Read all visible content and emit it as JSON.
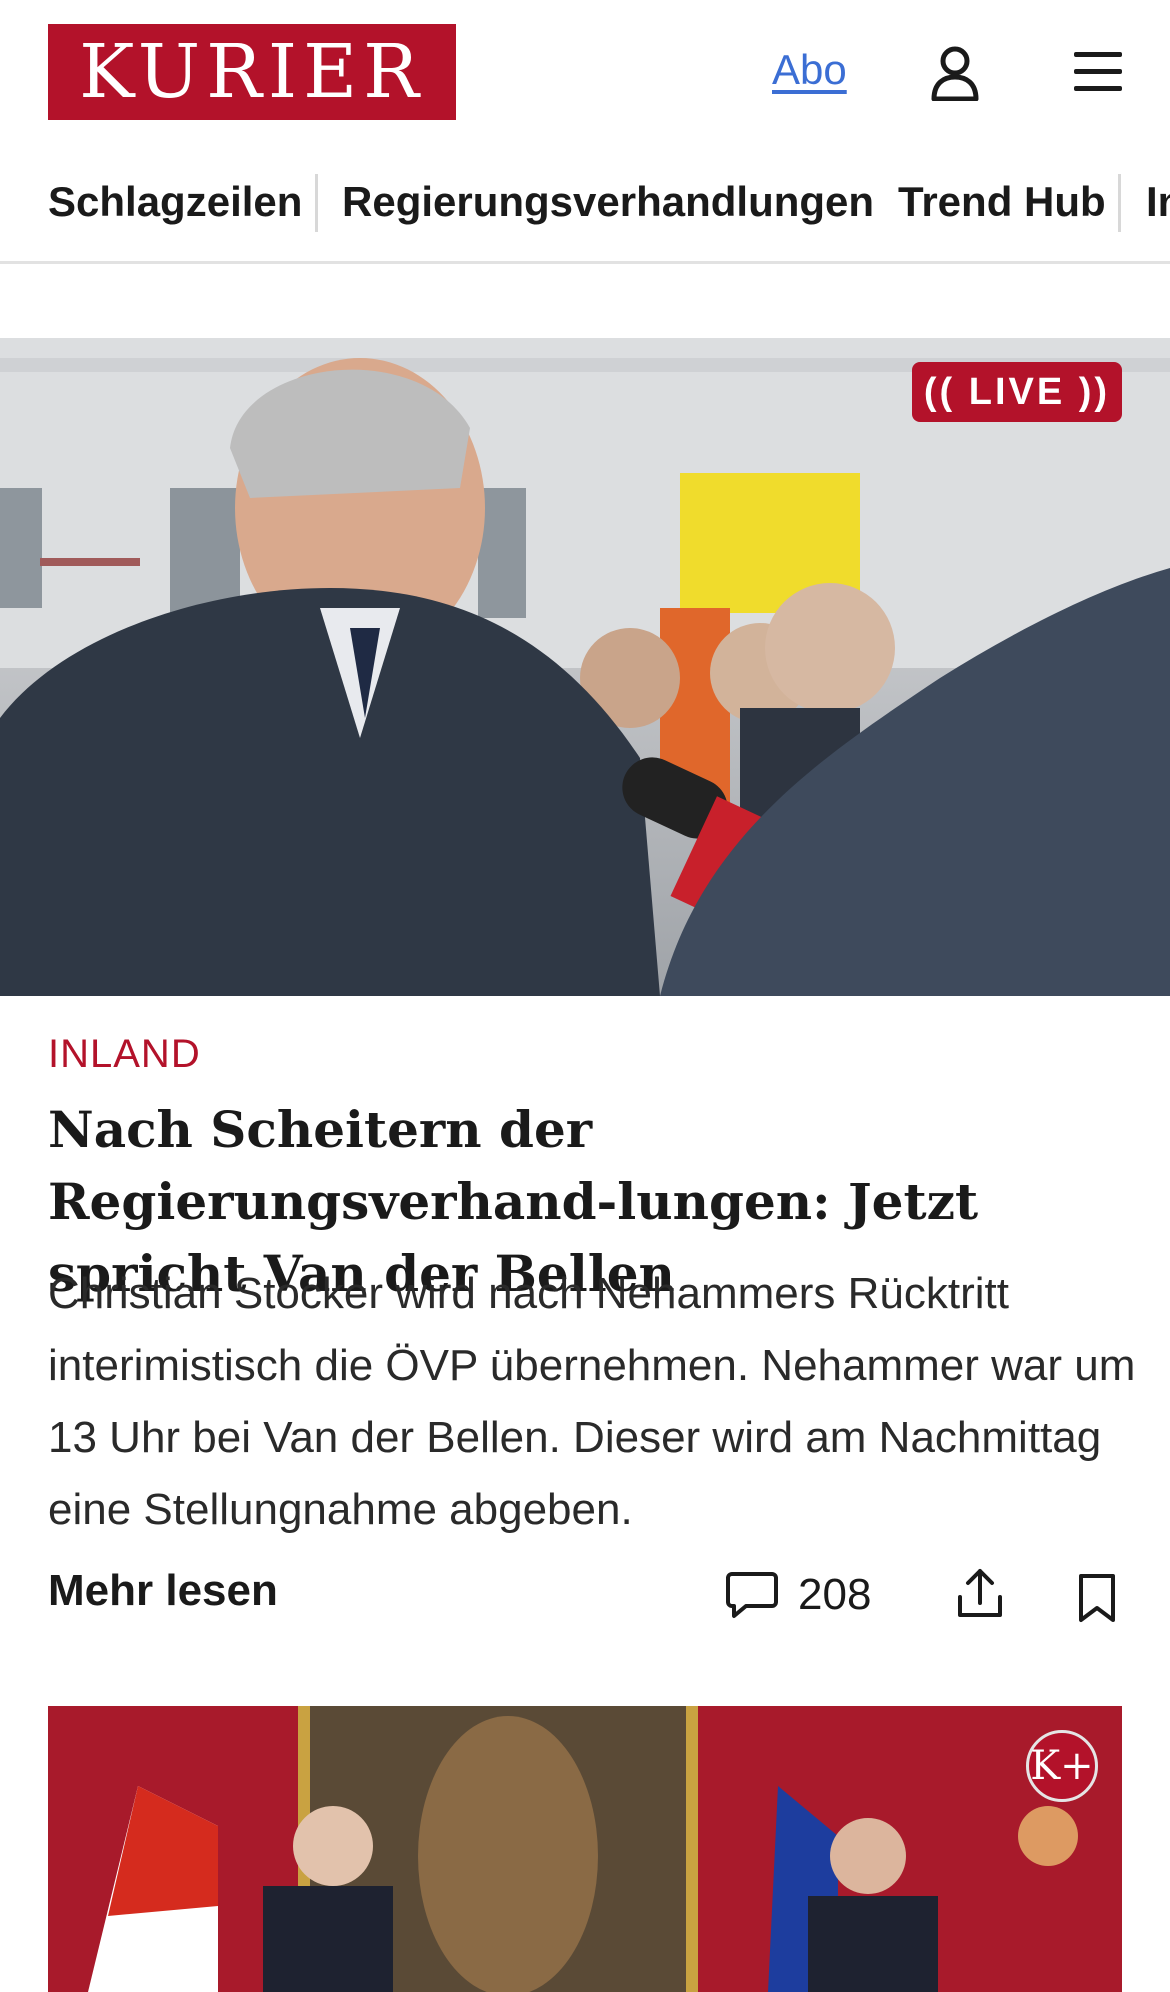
{
  "header": {
    "logo_text": "KURIER",
    "abo_label": "Abo",
    "user_icon": "user-icon",
    "menu_icon": "hamburger-menu-icon"
  },
  "nav": {
    "items": [
      {
        "label": "Schlagzeilen"
      },
      {
        "label": "Regierungsverhandlungen"
      },
      {
        "label": "Trend Hub"
      },
      {
        "label": "In"
      }
    ]
  },
  "hero": {
    "image_desc": "man-in-dark-coat-speaking-to-press",
    "live_badge": "(( LIVE ))"
  },
  "article": {
    "kicker": "INLAND",
    "headline": "Nach Scheitern der Regierungsverhand-lungen: Jetzt spricht Van der Bellen",
    "teaser": "Christian Stocker wird nach Nehammers Rücktritt interimistisch die ÖVP übernehmen. Nehammer war um 13 Uhr bei Van der Bellen. Dieser wird am Nachmittag eine Stellungnahme abgeben.",
    "more_label": "Mehr lesen",
    "comment_count": "208",
    "comment_icon": "comment-icon",
    "share_icon": "share-icon",
    "bookmark_icon": "bookmark-icon"
  },
  "card2": {
    "badge": "K+"
  },
  "colors": {
    "brand": "#b3122a",
    "link": "#3b6ed4",
    "text": "#1a1a1a"
  }
}
